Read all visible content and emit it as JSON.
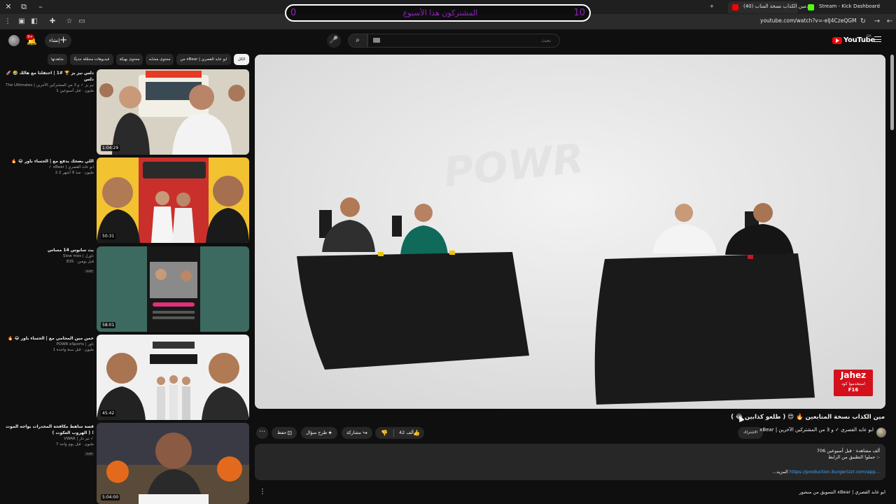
{
  "browser": {
    "tabs": [
      {
        "label": "(40) مين الكذاب نسخة المتاب..."
      },
      {
        "label": "Stream - Kick Dashboard"
      }
    ],
    "new_tab_label": "+",
    "url": "youtube.com/watch?v=-eIJ4CzeQGM"
  },
  "stream_overlay": {
    "left_count": "0",
    "title": "المشتركون هذا الأسبوع",
    "right_count": "10",
    "color": "#8c25b8"
  },
  "header": {
    "create_label": "إنشاء",
    "notification_count": "9+",
    "search_placeholder": "بحث",
    "logo_text": "YouTube",
    "logo_region": "SA"
  },
  "chips": [
    {
      "label": "الكل",
      "active": true
    },
    {
      "label": "من xBear | ابو عابد القصري"
    },
    {
      "label": "محتوى مشابه"
    },
    {
      "label": "محتوى بهيكة"
    },
    {
      "label": "فيديوهات محمّلة حديثًا"
    },
    {
      "label": "شاهدتها"
    }
  ],
  "recommended": [
    {
      "title": "🚀 🤣 دلس نيز يز 🏆 #1 | احتفلنا مع هالك دلس",
      "channel": "The Ultimates | نيز يز ✓ و 3 من المشتركين الآخرين",
      "meta": "1 مليون · قبل أسبوعين",
      "badge": "",
      "duration": "1:04:29"
    },
    {
      "title": "🔥 😂 اللي يضحك يدفع مع | الحساء باور",
      "channel": "✓ xBear | ابو عابد القصري",
      "meta": "2.2 مليون · منذ 9 أشهر",
      "badge": "",
      "duration": "50:31"
    },
    {
      "title": "بث سابوس 14 مساس",
      "channel": "Slow mos | ناورل",
      "meta": "835 · قبل يومين",
      "badge": "جديد",
      "duration": "58:01"
    },
    {
      "title": "🔥 😂 خمن مين المحامي مع | الحساء باور",
      "channel": "POWR eSports | ناور",
      "meta": "1 مليون · قبل سنة واحدة",
      "badge": "",
      "duration": "45:42"
    },
    {
      "title": "قصة ساهط مكافحة المخدرات يواجه الموت ( الهروب العكوت ) !",
      "channel": "VWAR | نيز دار ✓",
      "meta": "7 مليون · قبل يوم واحد",
      "badge": "جديد",
      "duration": "5:04:00"
    }
  ],
  "video": {
    "title": "مين الكذاب نسخة المتابعين 🔥 😍 ( طلعو كذابين 😂 )",
    "sponsor_brand": "Jahez",
    "sponsor_line": "استخدموا كود",
    "sponsor_code": "F16",
    "like_count": "42 ألف",
    "share_label": "مشاركة",
    "ask_label": "طرح سؤال",
    "save_label": "حفظ",
    "subscribe_label": "الاشتراك",
    "channel_name": "xBear | ابو عابد القصري ✓ و 3 من المشتركين الآخرين",
    "views_line": "706 ألف مشاهدة · قبل أسبوعين",
    "desc_line": "حملوا التطبيق من الرابط :-",
    "desc_link": "https://production.burgerizzr.com/app...",
    "more_label": "...المزيد",
    "bottom_text": "التسويق من منشور xBear | ابو عابد القصري"
  },
  "colors": {
    "background": "#0f0f0f",
    "surface": "#272727",
    "accent_red": "#ff0000",
    "link": "#3ea6ff",
    "jahez_red": "#d3101c"
  }
}
